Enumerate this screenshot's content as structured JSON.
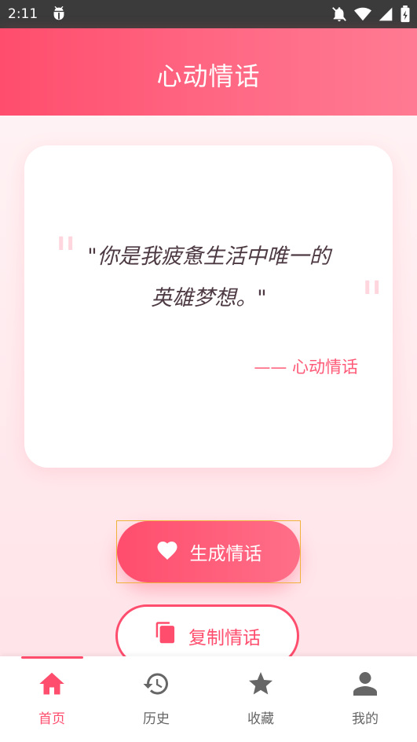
{
  "status_bar": {
    "time": "2:11",
    "icons": [
      "bug-icon",
      "mute-icon",
      "wifi-icon",
      "signal-icon",
      "battery-icon"
    ]
  },
  "header": {
    "title": "心动情话"
  },
  "card": {
    "quote": "\"你是我疲惫生活中唯一的英雄梦想。\"",
    "author": "—— 心动情话"
  },
  "buttons": {
    "generate": {
      "label": "生成情话",
      "icon": "heart-icon"
    },
    "copy": {
      "label": "复制情话",
      "icon": "copy-icon"
    }
  },
  "tabs": [
    {
      "label": "首页",
      "icon": "home-icon",
      "active": true
    },
    {
      "label": "历史",
      "icon": "history-icon",
      "active": false
    },
    {
      "label": "收藏",
      "icon": "star-icon",
      "active": false
    },
    {
      "label": "我的",
      "icon": "user-icon",
      "active": false
    }
  ],
  "colors": {
    "accent": "#ff4d6d",
    "header_gradient_end": "#ff7a92",
    "background": "#fff2f4",
    "quote_text": "#4d3a43",
    "inactive_tab": "#666666"
  }
}
